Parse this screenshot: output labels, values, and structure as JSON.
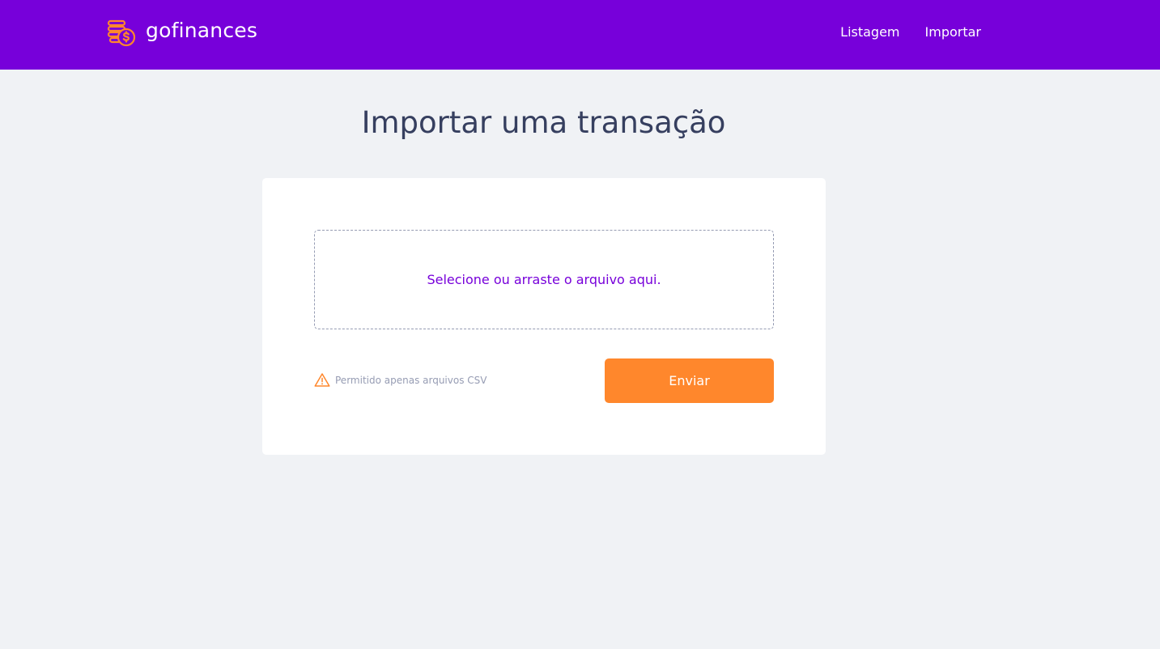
{
  "header": {
    "brand": "gofinances",
    "logo_icon": "coins-dollar-icon",
    "nav": [
      {
        "label": "Listagem"
      },
      {
        "label": "Importar"
      }
    ]
  },
  "main": {
    "title": "Importar uma transação",
    "dropzone": {
      "text": "Selecione ou arraste o arquivo aqui."
    },
    "hint": {
      "icon": "warning-icon",
      "text": "Permitido apenas arquivos CSV"
    },
    "submit_label": "Enviar"
  },
  "colors": {
    "header_bg": "#7700DA",
    "page_bg": "#F0F2F5",
    "accent": "#FF872C",
    "title": "#363F5F",
    "muted": "#969CB3"
  }
}
